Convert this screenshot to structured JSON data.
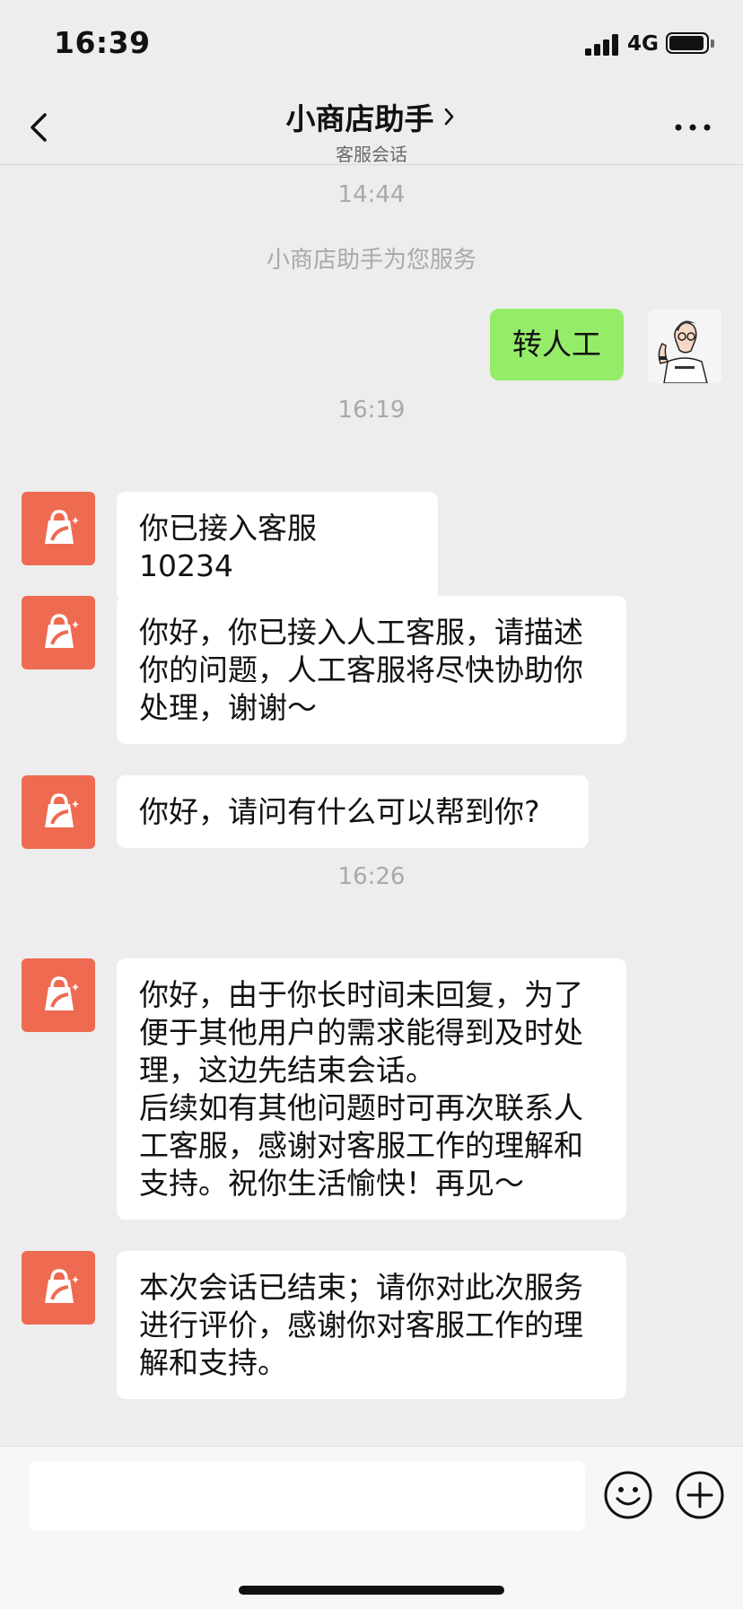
{
  "status_bar": {
    "time": "16:39",
    "network": "4G",
    "battery_level": 0.95,
    "signal_icon": "signal-bars-icon",
    "battery_icon": "battery-icon"
  },
  "header": {
    "title": "小商店助手",
    "subtitle": "客服会话",
    "back_icon": "chevron-left-icon",
    "more_icon": "more-dots-icon"
  },
  "chat": {
    "timestamps": [
      "14:44",
      "16:19",
      "16:26"
    ],
    "system_message": "小商店助手为您服务",
    "my_message": "转人工",
    "bot_messages": [
      "你已接入客服 10234",
      "你好，你已接入人工客服，请描述\n你的问题，人工客服将尽快协助你\n处理，谢谢～",
      "你好，请问有什么可以帮到你?",
      "你好，由于你长时间未回复，为了\n便于其他用户的需求能得到及时处\n理，这边先结束会话。\n后续如有其他问题时可再次联系人\n工客服，感谢对客服工作的理解和\n支持。祝你生活愉快！再见～",
      "本次会话已结束；请你对此次服务\n进行评价，感谢你对客服工作的理\n解和支持。"
    ]
  },
  "input_bar": {
    "input_value": "",
    "emoji_icon": "emoji-icon",
    "plus_icon": "plus-circle-icon"
  },
  "colors": {
    "background": "#ededed",
    "my_bubble": "#95ec69",
    "shop_avatar": "#ee6a50",
    "timestamp_text": "#a9a9a9"
  }
}
